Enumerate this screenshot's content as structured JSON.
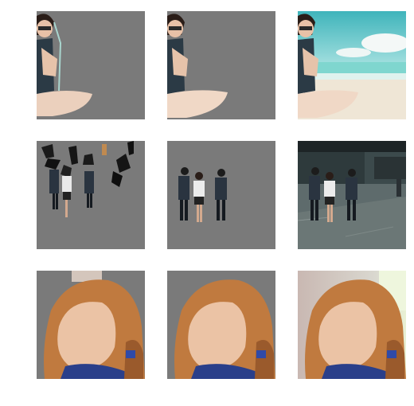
{
  "grid": {
    "rows": [
      {
        "subject": "woman-meditating-on-beach",
        "cells": [
          {
            "variant": "coarse-mask"
          },
          {
            "variant": "refined-mask"
          },
          {
            "variant": "original-photo"
          }
        ]
      },
      {
        "subject": "people-walking-in-city-street",
        "cells": [
          {
            "variant": "coarse-mask"
          },
          {
            "variant": "refined-mask"
          },
          {
            "variant": "original-photo"
          }
        ]
      },
      {
        "subject": "smiling-woman-face-closeup",
        "cells": [
          {
            "variant": "coarse-mask"
          },
          {
            "variant": "refined-mask"
          },
          {
            "variant": "original-photo"
          }
        ]
      }
    ]
  },
  "colors": {
    "mask_gray": "#7a7a7a",
    "sky": "#5fc3c8",
    "sea": "#7fd6cf",
    "sand": "#efe6d6",
    "skin": "#e9c8b2",
    "hair": "#c07a3f",
    "street": "#4a5a5c"
  }
}
